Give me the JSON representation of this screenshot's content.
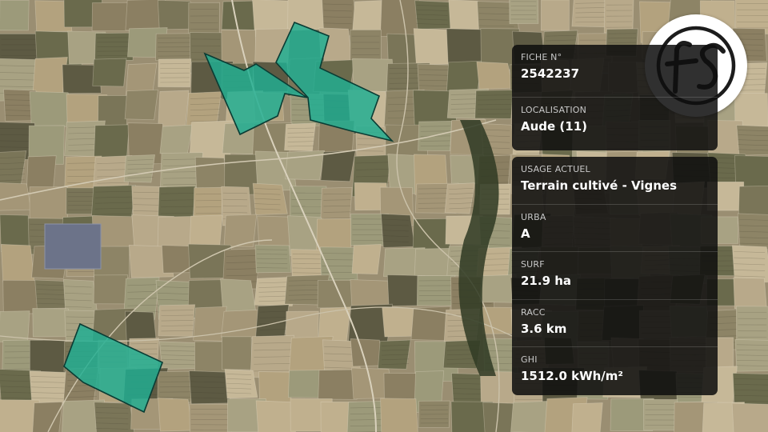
{
  "map": {
    "type": "satellite",
    "colors": {
      "parcel_fill": "#1fae93",
      "parcel_stroke": "#0a3c34",
      "field_light": "#c2b393",
      "field_dark": "#5f5a44"
    }
  },
  "logo": {
    "text": "fs",
    "icon": "brand-logo-icon"
  },
  "info_card": {
    "fiche": {
      "label": "FICHE N°",
      "value": "2542237"
    },
    "localisation": {
      "label": "LOCALISATION",
      "value": "Aude (11)"
    }
  },
  "details_card": {
    "usage": {
      "label": "USAGE ACTUEL",
      "value": "Terrain cultivé - Vignes"
    },
    "urba": {
      "label": "URBA",
      "value": "A"
    },
    "surf": {
      "label": "SURF",
      "value": "21.9 ha"
    },
    "racc": {
      "label": "RACC",
      "value": "3.6 km"
    },
    "ghi": {
      "label": "GHI",
      "value": "1512.0 kWh/m²"
    }
  }
}
